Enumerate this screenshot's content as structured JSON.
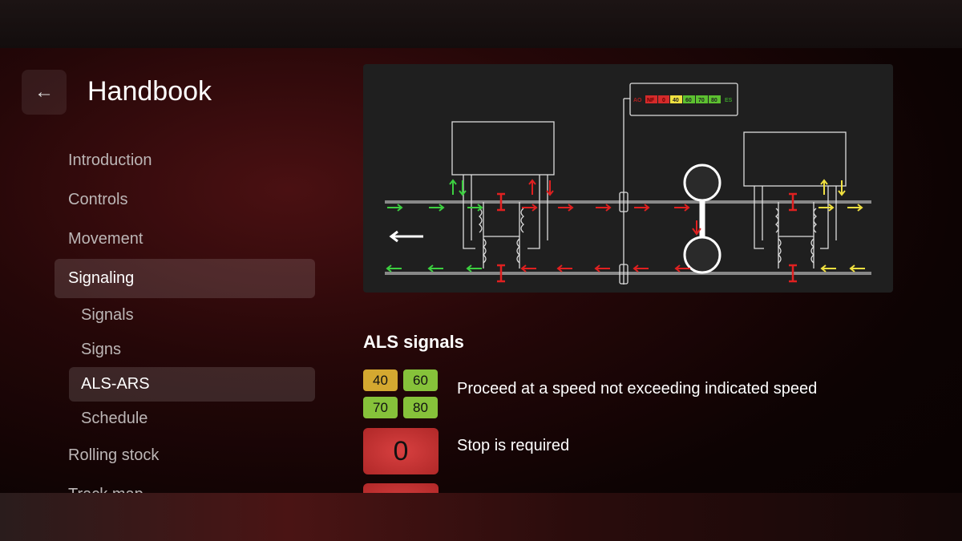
{
  "header": {
    "title": "Handbook",
    "back_icon": "arrow-left-icon"
  },
  "nav": {
    "items": [
      {
        "label": "Introduction"
      },
      {
        "label": "Controls"
      },
      {
        "label": "Movement"
      },
      {
        "label": "Signaling",
        "active": true
      }
    ],
    "subitems": [
      {
        "label": "Signals"
      },
      {
        "label": "Signs"
      },
      {
        "label": "ALS-ARS",
        "active": true
      },
      {
        "label": "Schedule"
      }
    ],
    "items_after": [
      {
        "label": "Rolling stock"
      },
      {
        "label": "Track map"
      }
    ]
  },
  "diagram": {
    "indicator": [
      "AO",
      "NF",
      "0",
      "40",
      "60",
      "70",
      "80",
      "ES"
    ],
    "indicator_colors": {
      "AO": "#b02020",
      "NF": "#d42a2a",
      "0": "#d42a2a",
      "40": "#f0e040",
      "60": "#5cc030",
      "70": "#5cc030",
      "80": "#5cc030",
      "ES": "#3a9a2a"
    },
    "arrow_colors": {
      "green": "#3cd040",
      "red": "#e02020",
      "yellow": "#f0e040",
      "white": "#ffffff"
    }
  },
  "section": {
    "title": "ALS signals",
    "rows": [
      {
        "chips": [
          {
            "label": "40",
            "color": "#d4a830"
          },
          {
            "label": "60",
            "color": "#86c23a"
          },
          {
            "label": "70",
            "color": "#86c23a"
          },
          {
            "label": "80",
            "color": "#86c23a"
          }
        ],
        "text": "Proceed at a speed not exceeding indicated speed"
      },
      {
        "chip": "0",
        "color": "#c83030",
        "text": "Stop is required"
      }
    ]
  }
}
